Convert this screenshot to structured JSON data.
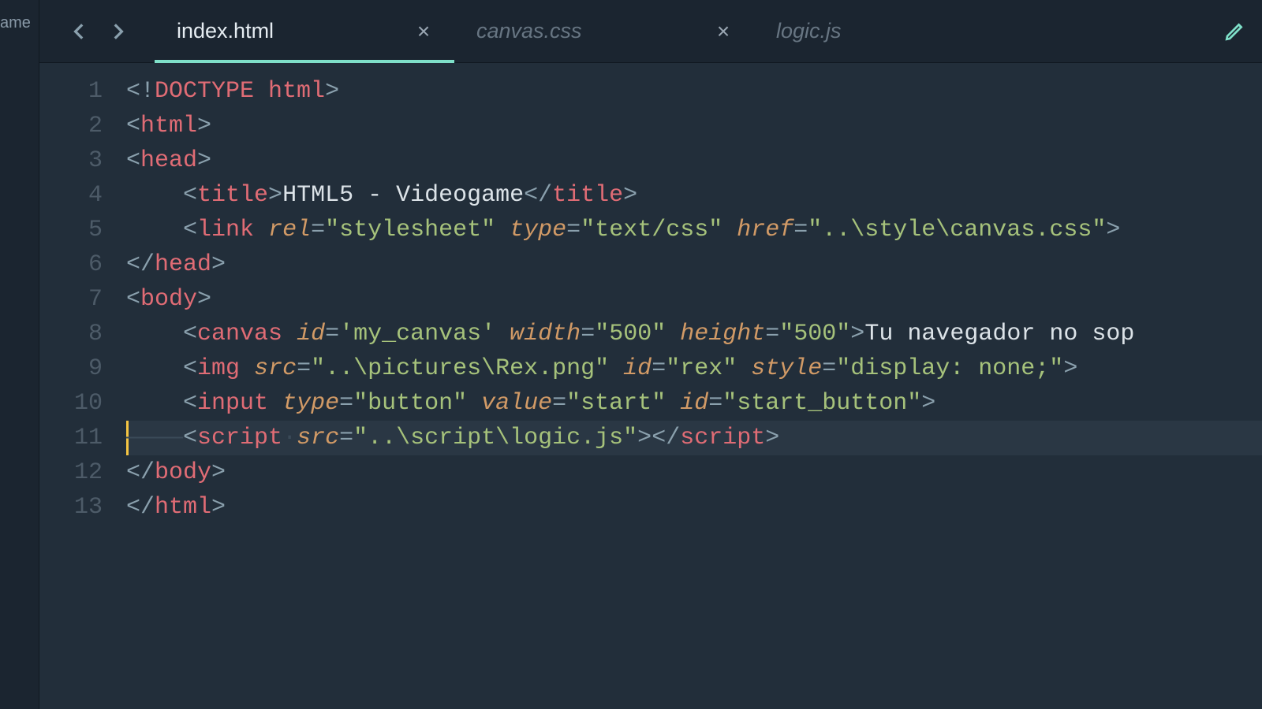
{
  "sidebar": {
    "project_label_fragment": "ame"
  },
  "tabs": {
    "nav_back": "‹",
    "nav_fwd": "›",
    "items": [
      {
        "label": "index.html",
        "active": true,
        "closeable": true
      },
      {
        "label": "canvas.css",
        "active": false,
        "closeable": true
      },
      {
        "label": "logic.js",
        "active": false,
        "closeable": false
      }
    ],
    "close_glyph": "×"
  },
  "code": {
    "lines": [
      {
        "n": 1,
        "indent": 0,
        "tokens": [
          [
            "pun",
            "<!"
          ],
          [
            "tag",
            "DOCTYPE html"
          ],
          [
            "pun",
            ">"
          ]
        ]
      },
      {
        "n": 2,
        "indent": 0,
        "tokens": [
          [
            "pun",
            "<"
          ],
          [
            "tag",
            "html"
          ],
          [
            "pun",
            ">"
          ]
        ]
      },
      {
        "n": 3,
        "indent": 0,
        "tokens": [
          [
            "pun",
            "<"
          ],
          [
            "tag",
            "head"
          ],
          [
            "pun",
            ">"
          ]
        ]
      },
      {
        "n": 4,
        "indent": 1,
        "tokens": [
          [
            "pun",
            "<"
          ],
          [
            "tag",
            "title"
          ],
          [
            "pun",
            ">"
          ],
          [
            "txt",
            "HTML5 - Videogame"
          ],
          [
            "pun",
            "</"
          ],
          [
            "tag",
            "title"
          ],
          [
            "pun",
            ">"
          ]
        ]
      },
      {
        "n": 5,
        "indent": 1,
        "tokens": [
          [
            "pun",
            "<"
          ],
          [
            "tag",
            "link"
          ],
          [
            "txt",
            " "
          ],
          [
            "attr",
            "rel"
          ],
          [
            "pun",
            "="
          ],
          [
            "str",
            "\"stylesheet\""
          ],
          [
            "txt",
            " "
          ],
          [
            "attr",
            "type"
          ],
          [
            "pun",
            "="
          ],
          [
            "str",
            "\"text/css\""
          ],
          [
            "txt",
            " "
          ],
          [
            "attr",
            "href"
          ],
          [
            "pun",
            "="
          ],
          [
            "str",
            "\"..\\style\\canvas.css\""
          ],
          [
            "pun",
            ">"
          ]
        ]
      },
      {
        "n": 6,
        "indent": 0,
        "tokens": [
          [
            "pun",
            "</"
          ],
          [
            "tag",
            "head"
          ],
          [
            "pun",
            ">"
          ]
        ]
      },
      {
        "n": 7,
        "indent": 0,
        "tokens": [
          [
            "pun",
            "<"
          ],
          [
            "tag",
            "body"
          ],
          [
            "pun",
            ">"
          ]
        ]
      },
      {
        "n": 8,
        "indent": 1,
        "tokens": [
          [
            "pun",
            "<"
          ],
          [
            "tag",
            "canvas"
          ],
          [
            "txt",
            " "
          ],
          [
            "attr",
            "id"
          ],
          [
            "pun",
            "="
          ],
          [
            "str",
            "'my_canvas'"
          ],
          [
            "txt",
            " "
          ],
          [
            "attr",
            "width"
          ],
          [
            "pun",
            "="
          ],
          [
            "str",
            "\"500\""
          ],
          [
            "txt",
            " "
          ],
          [
            "attr",
            "height"
          ],
          [
            "pun",
            "="
          ],
          [
            "str",
            "\"500\""
          ],
          [
            "pun",
            ">"
          ],
          [
            "txt",
            "Tu navegador no sop"
          ]
        ]
      },
      {
        "n": 9,
        "indent": 1,
        "tokens": [
          [
            "pun",
            "<"
          ],
          [
            "tag",
            "img"
          ],
          [
            "txt",
            " "
          ],
          [
            "attr",
            "src"
          ],
          [
            "pun",
            "="
          ],
          [
            "str",
            "\"..\\pictures\\Rex.png\""
          ],
          [
            "txt",
            " "
          ],
          [
            "attr",
            "id"
          ],
          [
            "pun",
            "="
          ],
          [
            "str",
            "\"rex\""
          ],
          [
            "txt",
            " "
          ],
          [
            "attr",
            "style"
          ],
          [
            "pun",
            "="
          ],
          [
            "str",
            "\"display: none;\""
          ],
          [
            "pun",
            ">"
          ]
        ]
      },
      {
        "n": 10,
        "indent": 1,
        "tokens": [
          [
            "pun",
            "<"
          ],
          [
            "tag",
            "input"
          ],
          [
            "txt",
            " "
          ],
          [
            "attr",
            "type"
          ],
          [
            "pun",
            "="
          ],
          [
            "str",
            "\"button\""
          ],
          [
            "txt",
            " "
          ],
          [
            "attr",
            "value"
          ],
          [
            "pun",
            "="
          ],
          [
            "str",
            "\"start\""
          ],
          [
            "txt",
            " "
          ],
          [
            "attr",
            "id"
          ],
          [
            "pun",
            "="
          ],
          [
            "str",
            "\"start_button\""
          ],
          [
            "pun",
            ">"
          ]
        ]
      },
      {
        "n": 11,
        "indent": 1,
        "selected": true,
        "tokens": [
          [
            "pun",
            "<"
          ],
          [
            "tag",
            "script"
          ],
          [
            "ind-dot",
            "·"
          ],
          [
            "attr",
            "src"
          ],
          [
            "pun",
            "="
          ],
          [
            "str",
            "\"..\\script\\logic.js\""
          ],
          [
            "pun",
            ">"
          ],
          [
            "pun",
            "</"
          ],
          [
            "tag",
            "script"
          ],
          [
            "pun",
            ">"
          ]
        ]
      },
      {
        "n": 12,
        "indent": 0,
        "tokens": [
          [
            "pun",
            "</"
          ],
          [
            "tag",
            "body"
          ],
          [
            "pun",
            ">"
          ]
        ]
      },
      {
        "n": 13,
        "indent": 0,
        "tokens": [
          [
            "pun",
            "</"
          ],
          [
            "tag",
            "html"
          ],
          [
            "pun",
            ">"
          ]
        ]
      }
    ]
  }
}
